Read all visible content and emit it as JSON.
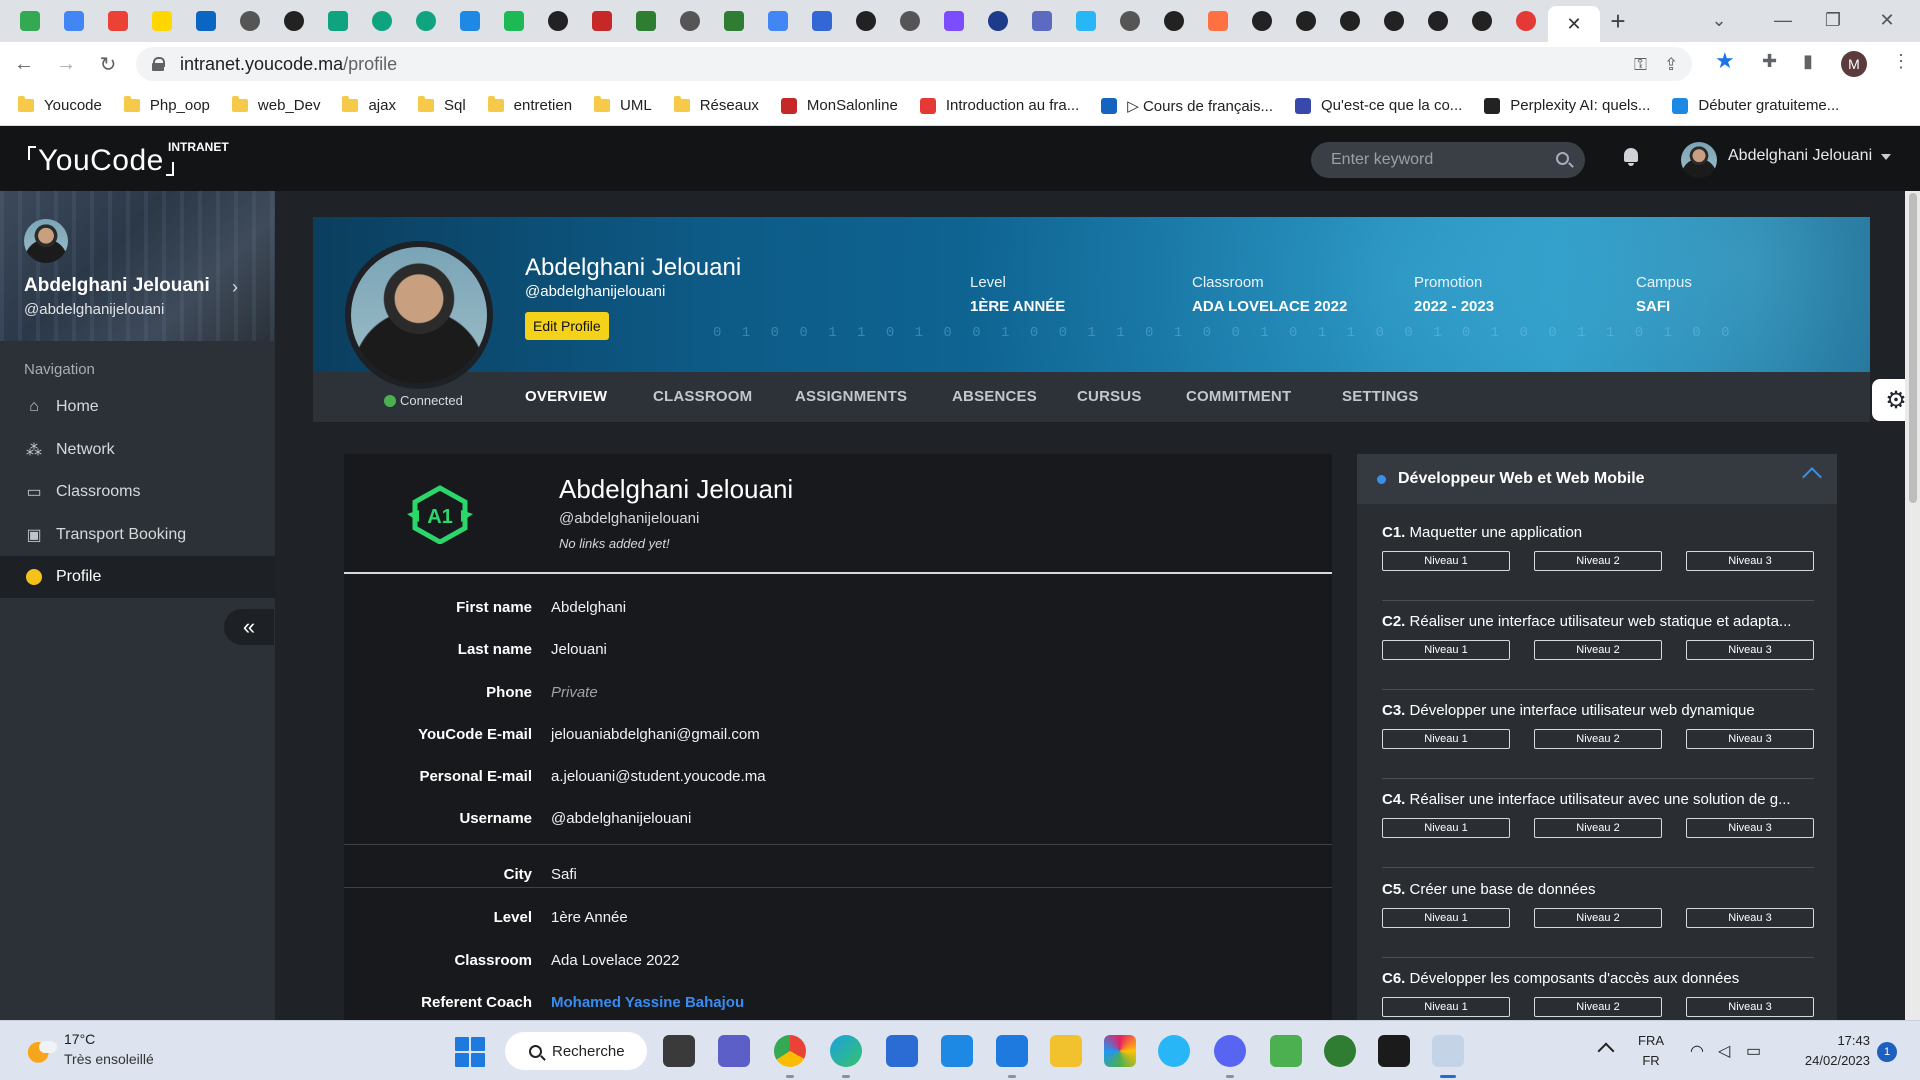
{
  "browser": {
    "tab_icons": [
      "gdrive-icon",
      "translate-icon",
      "gmail-icon",
      "ukraine-icon",
      "linkedin-icon",
      "tab-icon",
      "chatgpt-icon",
      "openai-icon",
      "chatgpt-icon",
      "chatgpt-icon",
      "brackets-icon",
      "spotify-icon",
      "chatgpt-icon",
      "wix-icon",
      "w-icon",
      "tab-icon",
      "w-icon",
      "google-icon",
      "docs-icon",
      "github-icon",
      "tab-icon",
      "notion-icon",
      "tab-icon",
      "php-icon",
      "react-icon",
      "tab-icon",
      "github-icon",
      "firefox-icon",
      "chatgpt-icon",
      "chatgpt-icon",
      "chatgpt-icon",
      "chatgpt-icon",
      "github-icon",
      "chatgpt-icon",
      "record-icon"
    ],
    "new_tab_label": "+",
    "url_host": "intranet.youcode.ma",
    "url_path": "/profile",
    "profile_initial": "M",
    "bookmarks": [
      {
        "label": "Youcode",
        "type": "folder"
      },
      {
        "label": "Php_oop",
        "type": "folder"
      },
      {
        "label": "web_Dev",
        "type": "folder"
      },
      {
        "label": "ajax",
        "type": "folder"
      },
      {
        "label": "Sql",
        "type": "folder"
      },
      {
        "label": "entretien",
        "type": "folder"
      },
      {
        "label": "UML",
        "type": "folder"
      },
      {
        "label": "Réseaux",
        "type": "folder"
      },
      {
        "label": "MonSalonline",
        "type": "site",
        "color": "#c62828"
      },
      {
        "label": "Introduction au fra...",
        "type": "site",
        "color": "#e53935"
      },
      {
        "label": "▷ Cours de français...",
        "type": "site",
        "color": "#1565c0"
      },
      {
        "label": "Qu'est-ce que la co...",
        "type": "site",
        "color": "#3949ab"
      },
      {
        "label": "Perplexity AI: quels...",
        "type": "site",
        "color": "#222222"
      },
      {
        "label": "Débuter gratuiteme...",
        "type": "site",
        "color": "#1e88e5"
      }
    ]
  },
  "header": {
    "logo": "YouCode",
    "logo_tag": "INTRANET",
    "search_placeholder": "Enter keyword",
    "user_name": "Abdelghani Jelouani"
  },
  "sidebar": {
    "name": "Abdelghani Jelouani",
    "handle": "@abdelghanijelouani",
    "nav_heading": "Navigation",
    "items": [
      {
        "label": "Home",
        "icon": "home-icon"
      },
      {
        "label": "Network",
        "icon": "network-icon"
      },
      {
        "label": "Classrooms",
        "icon": "classroom-icon"
      },
      {
        "label": "Transport Booking",
        "icon": "bus-icon"
      },
      {
        "label": "Profile",
        "icon": "user-icon",
        "active": true
      }
    ],
    "collapse_label": "«"
  },
  "profile": {
    "name": "Abdelghani Jelouani",
    "handle": "@abdelghanijelouani",
    "edit_label": "Edit Profile",
    "status": "Connected",
    "stats": [
      {
        "label": "Level",
        "value": "1ÈRE ANNÉE"
      },
      {
        "label": "Classroom",
        "value": "ADA LOVELACE 2022"
      },
      {
        "label": "Promotion",
        "value": "2022 - 2023"
      },
      {
        "label": "Campus",
        "value": "SAFI"
      }
    ],
    "tabs": [
      "OVERVIEW",
      "CLASSROOM",
      "ASSIGNMENTS",
      "ABSENCES",
      "CURSUS",
      "COMMITMENT",
      "SETTINGS"
    ],
    "binary_text": "0 1 0 0 1 1 0 1 0 0 1 0 0 1 1 0 1 0 0 1 0 1 1 0 0 1 0 1 0 0 1 1 0 1 0 0"
  },
  "info_card": {
    "badge_text": "A1",
    "name": "Abdelghani Jelouani",
    "handle": "@abdelghanijelouani",
    "links_note": "No links added yet!",
    "fields": [
      {
        "label": "First name",
        "value": "Abdelghani"
      },
      {
        "label": "Last name",
        "value": "Jelouani"
      },
      {
        "label": "Phone",
        "value": "Private"
      },
      {
        "label": "YouCode E-mail",
        "value": "jelouaniabdelghani@gmail.com"
      },
      {
        "label": "Personal E-mail",
        "value": "a.jelouani@student.youcode.ma"
      },
      {
        "label": "Username",
        "value": "@abdelghanijelouani"
      }
    ],
    "fields2": [
      {
        "label": "City",
        "value": "Safi"
      },
      {
        "label": "Level",
        "value": "1ère Année"
      },
      {
        "label": "Classroom",
        "value": "Ada Lovelace 2022"
      },
      {
        "label": "Referent Coach",
        "value": "Mohamed Yassine Bahajou"
      }
    ]
  },
  "skills": {
    "title": "Développeur Web et Web Mobile",
    "levels": [
      "Niveau 1",
      "Niveau 2",
      "Niveau 3"
    ],
    "items": [
      {
        "code": "C1.",
        "text": "Maquetter une application"
      },
      {
        "code": "C2.",
        "text": "Réaliser une interface utilisateur web statique et adapta..."
      },
      {
        "code": "C3.",
        "text": "Développer une interface utilisateur web dynamique"
      },
      {
        "code": "C4.",
        "text": "Réaliser une interface utilisateur avec une solution de g..."
      },
      {
        "code": "C5.",
        "text": "Créer une base de données"
      },
      {
        "code": "C6.",
        "text": "Développer les composants d'accès aux données"
      }
    ]
  },
  "taskbar": {
    "temperature": "17°C",
    "weather": "Très ensoleillé",
    "search_label": "Recherche",
    "lang_top": "FRA",
    "lang_bottom": "FR",
    "time": "17:43",
    "date": "24/02/2023",
    "notifications": "1"
  }
}
